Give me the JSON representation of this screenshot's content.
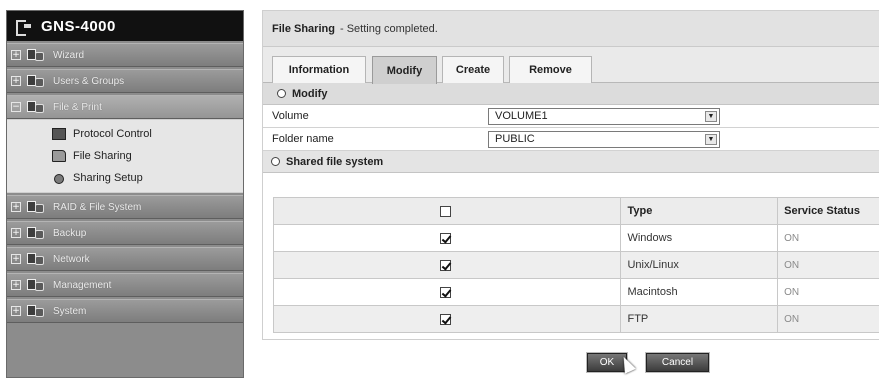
{
  "sidebar": {
    "brand": "GNS-4000",
    "items": [
      {
        "label": "Wizard",
        "icon": "wizard-icon",
        "open": false
      },
      {
        "label": "Users & Groups",
        "icon": "users-groups-icon",
        "open": false
      },
      {
        "label": "File & Print",
        "icon": "file-print-icon",
        "open": true
      },
      {
        "label": "RAID & File System",
        "icon": "raid-icon",
        "open": false
      },
      {
        "label": "Backup",
        "icon": "backup-icon",
        "open": false
      },
      {
        "label": "Network",
        "icon": "network-icon",
        "open": false
      },
      {
        "label": "Management",
        "icon": "management-icon",
        "open": false
      },
      {
        "label": "System",
        "icon": "system-icon",
        "open": false
      }
    ],
    "subitems": [
      {
        "label": "Protocol Control",
        "icon": "protocol-control-icon"
      },
      {
        "label": "File Sharing",
        "icon": "file-sharing-icon"
      },
      {
        "label": "Sharing Setup",
        "icon": "sharing-setup-icon"
      }
    ],
    "expand_plus": "+",
    "expand_minus": "−"
  },
  "main": {
    "title": "File Sharing",
    "status": "- Setting completed.",
    "tabs": [
      "Information",
      "Modify",
      "Create",
      "Remove"
    ],
    "active_tab": "Modify",
    "modify_section": "Modify",
    "volume_label": "Volume",
    "volume_value": "VOLUME1",
    "folder_label": "Folder name",
    "folder_value": "PUBLIC",
    "shared_section": "Shared file system",
    "table": {
      "headers": [
        "",
        "Type",
        "Service Status"
      ],
      "rows": [
        {
          "checked": true,
          "type": "Windows",
          "status": "ON"
        },
        {
          "checked": true,
          "type": "Unix/Linux",
          "status": "ON"
        },
        {
          "checked": true,
          "type": "Macintosh",
          "status": "ON"
        },
        {
          "checked": true,
          "type": "FTP",
          "status": "ON"
        }
      ]
    }
  },
  "buttons": {
    "ok": "OK",
    "cancel": "Cancel"
  }
}
